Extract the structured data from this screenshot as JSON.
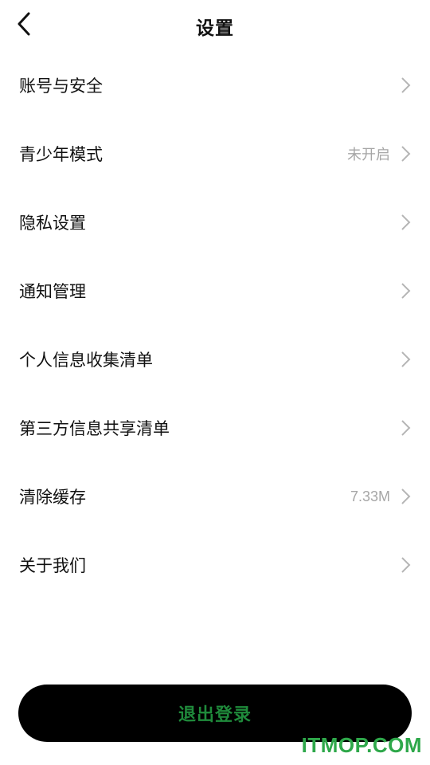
{
  "header": {
    "title": "设置",
    "back_icon": "chevron-left-icon"
  },
  "menu": {
    "items": [
      {
        "label": "账号与安全",
        "value": ""
      },
      {
        "label": "青少年模式",
        "value": "未开启"
      },
      {
        "label": "隐私设置",
        "value": ""
      },
      {
        "label": "通知管理",
        "value": ""
      },
      {
        "label": "个人信息收集清单",
        "value": ""
      },
      {
        "label": "第三方信息共享清单",
        "value": ""
      },
      {
        "label": "清除缓存",
        "value": "7.33M"
      },
      {
        "label": "关于我们",
        "value": ""
      }
    ],
    "chevron_icon": "chevron-right-icon"
  },
  "footer": {
    "logout_label": "退出登录"
  },
  "watermark": {
    "text": "ITMOP.COM"
  },
  "colors": {
    "background": "#ffffff",
    "text": "#111111",
    "secondary_text": "#a6a6a6",
    "chevron": "#b5b5b5",
    "button_bg": "#000000",
    "button_text": "#1f8a3b",
    "watermark": "#2ea84a"
  }
}
